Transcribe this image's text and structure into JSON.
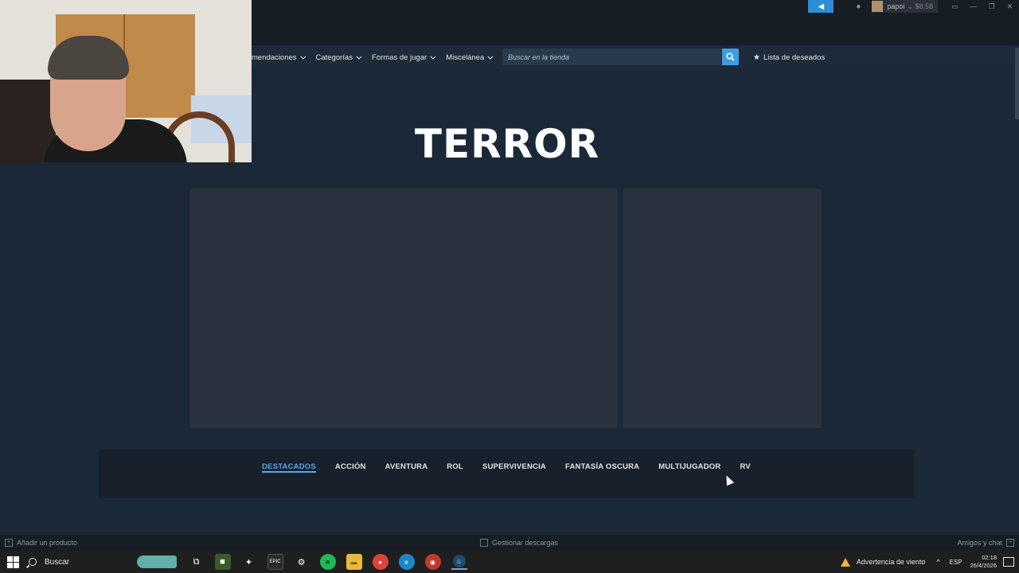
{
  "titlebar": {
    "username": "papoi",
    "balance": "$8.58"
  },
  "nav": {
    "items": [
      {
        "label": "mendaciones"
      },
      {
        "label": "Categorías"
      },
      {
        "label": "Formas de jugar"
      },
      {
        "label": "Miscelánea"
      }
    ],
    "search_placeholder": "Buscar en la tienda",
    "wishlist_label": "Lista de deseados"
  },
  "page": {
    "title": "TERROR"
  },
  "tabs": [
    {
      "label": "DESTACADOS",
      "active": true
    },
    {
      "label": "ACCIÓN"
    },
    {
      "label": "AVENTURA"
    },
    {
      "label": "ROL"
    },
    {
      "label": "SUPERVIVENCIA"
    },
    {
      "label": "FANTASÍA OSCURA"
    },
    {
      "label": "MULTIJUGADOR"
    },
    {
      "label": "RV"
    }
  ],
  "steam_bottom": {
    "add_product": "Añadir un producto",
    "manage_downloads": "Gestionar descargas",
    "friends_chat": "Amigos y chat"
  },
  "taskbar": {
    "search_label": "Buscar",
    "weather_warning": "Advertencia de viento",
    "language": "ESP",
    "time": "02:18",
    "date": "26/4/2026"
  },
  "colors": {
    "background": "#1b2838",
    "accent": "#58a8ea",
    "search_button": "#3d9de0"
  }
}
